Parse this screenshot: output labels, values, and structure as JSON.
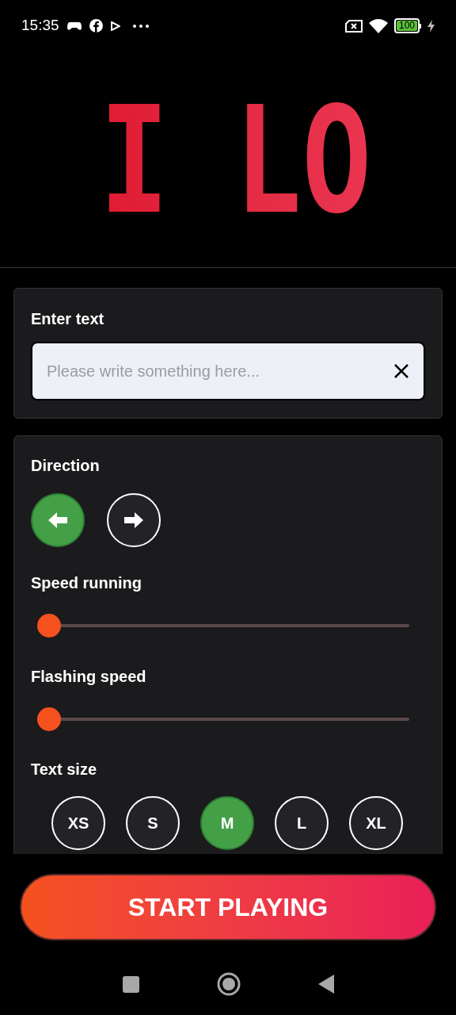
{
  "status_bar": {
    "time": "15:35",
    "battery": "100"
  },
  "preview": {
    "text": "I LO"
  },
  "text_input": {
    "label": "Enter text",
    "placeholder": "Please write something here..."
  },
  "direction": {
    "label": "Direction",
    "options": [
      {
        "kind": "left",
        "selected": true
      },
      {
        "kind": "right",
        "selected": false
      }
    ]
  },
  "speed_running": {
    "label": "Speed running",
    "level": 0
  },
  "flashing_speed": {
    "label": "Flashing speed",
    "level": 0
  },
  "text_size": {
    "label": "Text size",
    "options": [
      {
        "label": "XS",
        "selected": false
      },
      {
        "label": "S",
        "selected": false
      },
      {
        "label": "M",
        "selected": true
      },
      {
        "label": "L",
        "selected": false
      },
      {
        "label": "XL",
        "selected": false
      }
    ]
  },
  "start_button": {
    "label": "START PLAYING"
  }
}
